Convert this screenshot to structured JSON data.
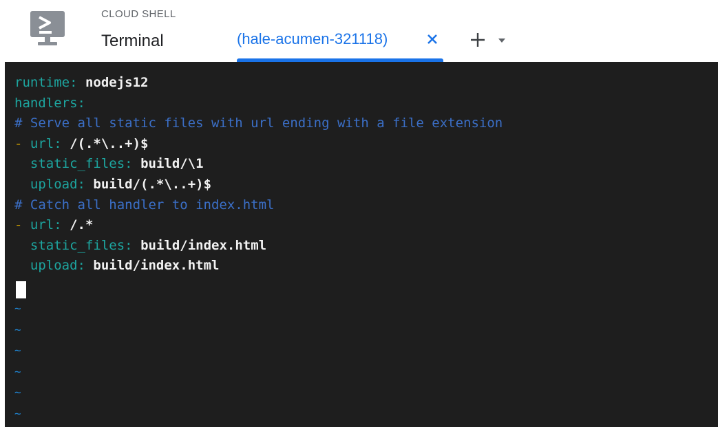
{
  "header": {
    "section_label": "CLOUD SHELL",
    "title": "Terminal",
    "icon": "cloud-shell-terminal-icon"
  },
  "tabs": [
    {
      "label": "(hale-acumen-321118)",
      "active": true
    }
  ],
  "tab_actions": {
    "close_icon": "close-icon",
    "add_icon": "plus-icon",
    "menu_icon": "caret-down-icon"
  },
  "editor": {
    "lines": [
      {
        "key": "runtime",
        "sep": ": ",
        "value": "nodejs12"
      },
      {
        "key": "handlers",
        "sep": ":",
        "value": ""
      },
      {
        "comment": "# Serve all static files with url ending with a file extension"
      },
      {
        "dash": "- ",
        "key": "url",
        "sep": ": ",
        "value": "/(.*\\..+)$"
      },
      {
        "indent": "  ",
        "key": "static_files",
        "sep": ": ",
        "value": "build/\\1"
      },
      {
        "indent": "  ",
        "key": "upload",
        "sep": ": ",
        "value": "build/(.*\\..+)$"
      },
      {
        "comment": "# Catch all handler to index.html"
      },
      {
        "dash": "- ",
        "key": "url",
        "sep": ": ",
        "value": "/.*"
      },
      {
        "indent": "  ",
        "key": "static_files",
        "sep": ": ",
        "value": "build/index.html"
      },
      {
        "indent": "  ",
        "key": "upload",
        "sep": ": ",
        "value": "build/index.html"
      }
    ],
    "tildes": [
      "~",
      "~",
      "~",
      "~",
      "~",
      "~"
    ]
  },
  "colors": {
    "accent": "#1a73e8",
    "terminal_bg": "#1e1e1e",
    "yaml_key": "#1da6a0",
    "yaml_comment": "#3b6fc7",
    "yaml_dash": "#c79a00"
  }
}
